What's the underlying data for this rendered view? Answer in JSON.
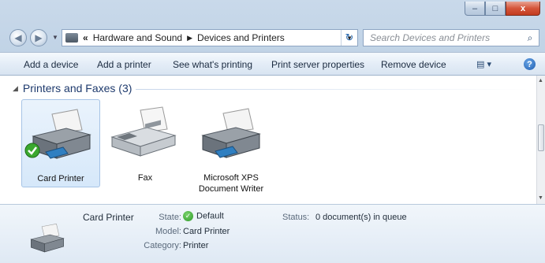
{
  "window": {
    "caption": {
      "minimize": "–",
      "maximize": "□",
      "close": "x"
    }
  },
  "navigation": {
    "back_icon": "back-arrow-icon",
    "forward_icon": "forward-arrow-icon",
    "breadcrumb": {
      "overflow": "«",
      "items": [
        "Hardware and Sound",
        "Devices and Printers"
      ],
      "separator": "▶"
    },
    "dropdown": "▼",
    "refresh": "↻",
    "search_placeholder": "Search Devices and Printers",
    "search_icon": "⌕"
  },
  "toolbar": {
    "items": [
      "Add a device",
      "Add a printer",
      "See what's printing",
      "Print server properties",
      "Remove device"
    ],
    "views_glyph": "▤ ▾",
    "help": "?"
  },
  "group": {
    "arrow": "◢",
    "title": "Printers and Faxes (3)"
  },
  "devices": [
    {
      "label": "Card Printer",
      "selected": true,
      "default": true,
      "icon": "printer-icon"
    },
    {
      "label": "Fax",
      "selected": false,
      "default": false,
      "icon": "fax-icon"
    },
    {
      "label_line1": "Microsoft XPS",
      "label_line2": "Document Writer",
      "selected": false,
      "default": false,
      "icon": "printer-icon"
    }
  ],
  "details": {
    "name": "Card Printer",
    "state_label": "State:",
    "state_value": "Default",
    "model_label": "Model:",
    "model_value": "Card Printer",
    "category_label": "Category:",
    "category_value": "Printer",
    "status_label": "Status:",
    "status_value": "0 document(s) in queue"
  },
  "colors": {
    "selection": "#d6e8fa",
    "default_check": "#2c9a26",
    "group_header": "#1e3a6d"
  }
}
